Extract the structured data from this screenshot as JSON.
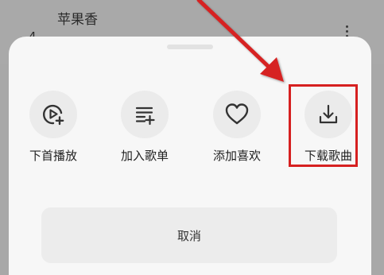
{
  "background": {
    "song_title": "苹果香",
    "song_index": "4",
    "more_icon": "more-vertical-icon"
  },
  "sheet": {
    "actions": [
      {
        "label": "下首播放",
        "icon": "play-next-icon"
      },
      {
        "label": "加入歌单",
        "icon": "add-to-playlist-icon"
      },
      {
        "label": "添加喜欢",
        "icon": "heart-icon"
      },
      {
        "label": "下载歌曲",
        "icon": "download-icon"
      }
    ],
    "cancel_label": "取消"
  },
  "annotation": {
    "color": "#d62020",
    "highlighted_action": "下载歌曲"
  }
}
